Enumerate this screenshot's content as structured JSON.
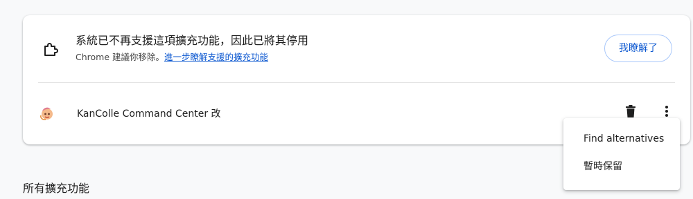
{
  "warning": {
    "title": "系統已不再支援這項擴充功能，因此已將其停用",
    "subtitle_prefix": "Chrome 建議你移除。",
    "learn_more_link": "進一步瞭解支援的擴充功能",
    "got_it_label": "我瞭解了",
    "icon": "puzzle-piece-icon"
  },
  "extension": {
    "name": "KanColle Command Center 改",
    "icon": "kancolle-extension-icon",
    "remove_icon": "trash-icon",
    "more_icon": "more-vert-icon"
  },
  "menu": {
    "items": [
      {
        "label": "Find alternatives"
      },
      {
        "label": "暫時保留"
      }
    ]
  },
  "section": {
    "all_extensions_title": "所有擴充功能"
  },
  "colors": {
    "accent": "#0b57d0",
    "button_border": "#a8c7fa",
    "page_background": "#f8f9fa"
  }
}
